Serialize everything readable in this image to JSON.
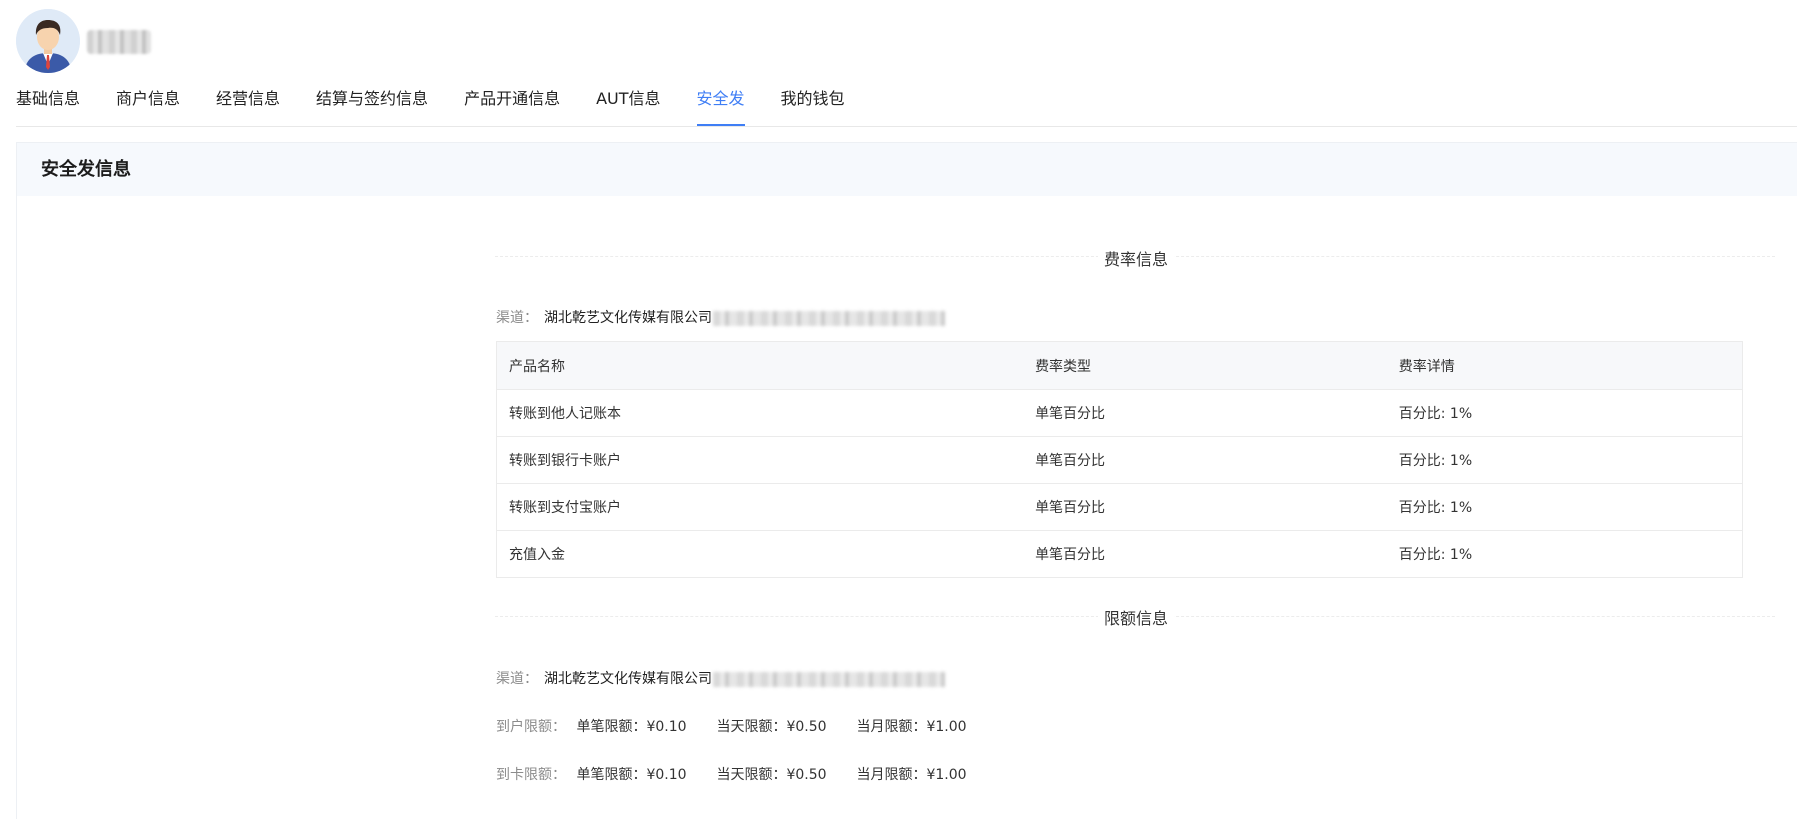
{
  "profile": {
    "username_redacted": ""
  },
  "tabs": [
    {
      "label": "基础信息",
      "active": false
    },
    {
      "label": "商户信息",
      "active": false
    },
    {
      "label": "经营信息",
      "active": false
    },
    {
      "label": "结算与签约信息",
      "active": false
    },
    {
      "label": "产品开通信息",
      "active": false
    },
    {
      "label": "AUT信息",
      "active": false
    },
    {
      "label": "安全发",
      "active": true
    },
    {
      "label": "我的钱包",
      "active": false
    }
  ],
  "panel": {
    "title": "安全发信息"
  },
  "fee_section": {
    "title": "费率信息",
    "channel_label": "渠道：",
    "channel_value": "湖北乾艺文化传媒有限公司",
    "table": {
      "headers": [
        "产品名称",
        "费率类型",
        "费率详情"
      ],
      "rows": [
        [
          "转账到他人记账本",
          "单笔百分比",
          "百分比: 1%"
        ],
        [
          "转账到银行卡账户",
          "单笔百分比",
          "百分比: 1%"
        ],
        [
          "转账到支付宝账户",
          "单笔百分比",
          "百分比: 1%"
        ],
        [
          "充值入金",
          "单笔百分比",
          "百分比: 1%"
        ]
      ]
    }
  },
  "limit_section": {
    "title": "限额信息",
    "channel_label": "渠道：",
    "channel_value": "湖北乾艺文化传媒有限公司",
    "rows": [
      {
        "label": "到户限额：",
        "single": "单笔限额：¥0.10",
        "daily": "当天限额：¥0.50",
        "monthly": "当月限额：¥1.00"
      },
      {
        "label": "到卡限额：",
        "single": "单笔限额：¥0.10",
        "daily": "当天限额：¥0.50",
        "monthly": "当月限额：¥1.00"
      }
    ]
  },
  "colors": {
    "accent": "#3f7ef5",
    "header_bg": "#f6f9fd",
    "muted_label": "#8c8c8c"
  }
}
